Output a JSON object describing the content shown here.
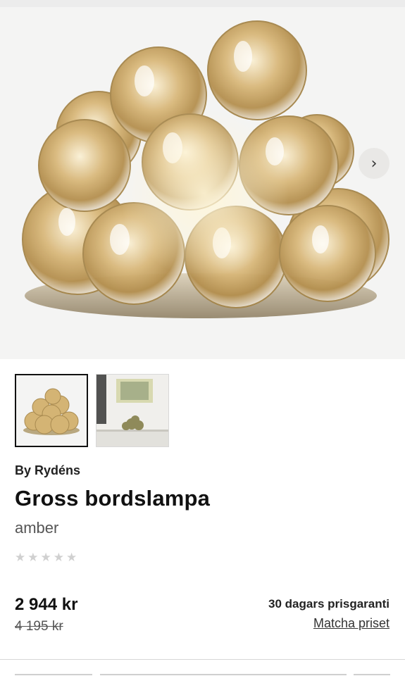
{
  "product": {
    "brand": "By Rydéns",
    "title": "Gross bordslampa",
    "variant": "amber",
    "rating": {
      "stars": 5,
      "filled": 0
    },
    "price": "2 944 kr",
    "old_price": "4 195 kr",
    "price_guarantee": "30 dagars prisgaranti",
    "match_price_link": "Matcha priset"
  },
  "gallery": {
    "next_icon": "chevron-right-icon",
    "next_glyph": "›",
    "thumbnails": [
      {
        "name": "lamp-front",
        "active": true
      },
      {
        "name": "lamp-room",
        "active": false
      }
    ]
  },
  "colors": {
    "amber": "#c9a664",
    "background": "#f4f4f3",
    "text": "#111111"
  }
}
